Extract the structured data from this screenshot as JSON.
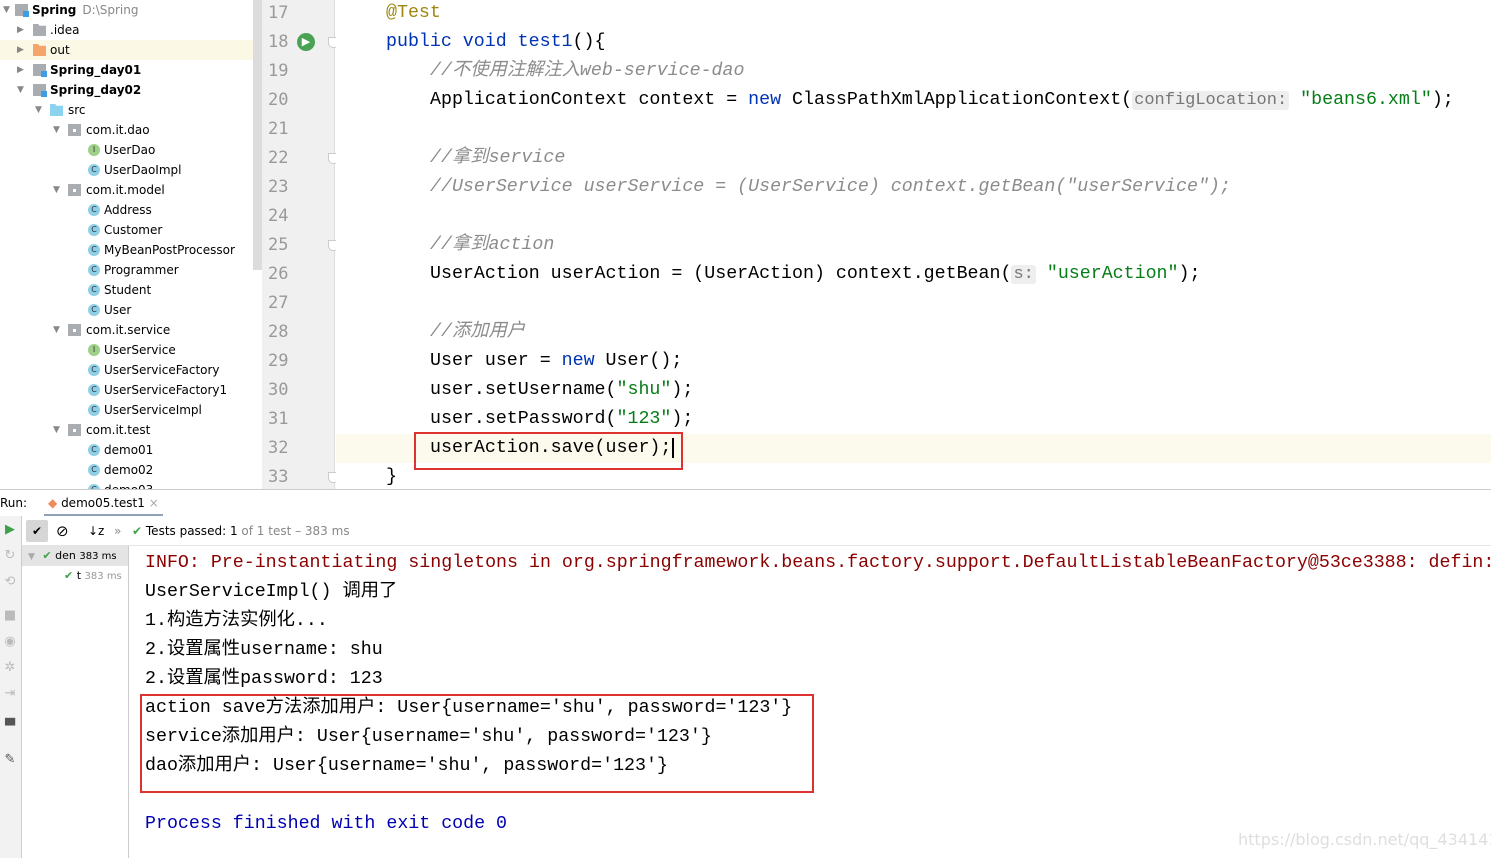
{
  "project_tree": [
    {
      "label": "Spring",
      "path": "D:\\Spring",
      "level": 0,
      "icon": "module",
      "expanded": true,
      "bold": true
    },
    {
      "label": ".idea",
      "level": 1,
      "icon": "folder",
      "expanded": false
    },
    {
      "label": "out",
      "level": 1,
      "icon": "folder-orange",
      "expanded": false,
      "selected": true
    },
    {
      "label": "Spring_day01",
      "level": 1,
      "icon": "module",
      "expanded": false,
      "bold": true
    },
    {
      "label": "Spring_day02",
      "level": 1,
      "icon": "module",
      "expanded": true,
      "bold": true
    },
    {
      "label": "src",
      "level": 2,
      "icon": "folder-blue",
      "expanded": true
    },
    {
      "label": "com.it.dao",
      "level": 3,
      "icon": "package",
      "expanded": true
    },
    {
      "label": "UserDao",
      "level": 4,
      "icon": "interface"
    },
    {
      "label": "UserDaoImpl",
      "level": 4,
      "icon": "class"
    },
    {
      "label": "com.it.model",
      "level": 3,
      "icon": "package",
      "expanded": true
    },
    {
      "label": "Address",
      "level": 4,
      "icon": "class"
    },
    {
      "label": "Customer",
      "level": 4,
      "icon": "class"
    },
    {
      "label": "MyBeanPostProcessor",
      "level": 4,
      "icon": "class"
    },
    {
      "label": "Programmer",
      "level": 4,
      "icon": "class"
    },
    {
      "label": "Student",
      "level": 4,
      "icon": "class"
    },
    {
      "label": "User",
      "level": 4,
      "icon": "class"
    },
    {
      "label": "com.it.service",
      "level": 3,
      "icon": "package",
      "expanded": true
    },
    {
      "label": "UserService",
      "level": 4,
      "icon": "interface"
    },
    {
      "label": "UserServiceFactory",
      "level": 4,
      "icon": "class"
    },
    {
      "label": "UserServiceFactory1",
      "level": 4,
      "icon": "class"
    },
    {
      "label": "UserServiceImpl",
      "level": 4,
      "icon": "class"
    },
    {
      "label": "com.it.test",
      "level": 3,
      "icon": "package",
      "expanded": true
    },
    {
      "label": "demo01",
      "level": 4,
      "icon": "test-class"
    },
    {
      "label": "demo02",
      "level": 4,
      "icon": "test-class"
    },
    {
      "label": "demo03",
      "level": 4,
      "icon": "test-class"
    }
  ],
  "editor": {
    "current_line": 32,
    "lines": [
      {
        "n": "17",
        "indent": 1,
        "tokens": [
          {
            "t": "@Test",
            "c": "ann"
          }
        ]
      },
      {
        "n": "18",
        "indent": 1,
        "tokens": [
          {
            "t": "public void ",
            "c": "kw"
          },
          {
            "t": "test1",
            "c": "kw"
          },
          {
            "t": "(){",
            "c": ""
          }
        ]
      },
      {
        "n": "19",
        "indent": 2,
        "tokens": [
          {
            "t": "//不使用注解注入web-service-dao",
            "c": "cm"
          }
        ]
      },
      {
        "n": "20",
        "indent": 2,
        "tokens": [
          {
            "t": "ApplicationContext context = ",
            "c": ""
          },
          {
            "t": "new ",
            "c": "kw"
          },
          {
            "t": "ClassPathXmlApplicationContext(",
            "c": ""
          },
          {
            "t": "configLocation:",
            "c": "hint"
          },
          {
            "t": " ",
            "c": ""
          },
          {
            "t": "\"beans6.xml\"",
            "c": "str"
          },
          {
            "t": ");",
            "c": ""
          }
        ]
      },
      {
        "n": "21",
        "indent": 2,
        "tokens": []
      },
      {
        "n": "22",
        "indent": 2,
        "tokens": [
          {
            "t": "//拿到service",
            "c": "cm"
          }
        ]
      },
      {
        "n": "23",
        "indent": 2,
        "tokens": [
          {
            "t": "//UserService userService = (UserService) context.getBean(\"userService\");",
            "c": "cm"
          }
        ]
      },
      {
        "n": "24",
        "indent": 2,
        "tokens": []
      },
      {
        "n": "25",
        "indent": 2,
        "tokens": [
          {
            "t": "//拿到action",
            "c": "cm"
          }
        ]
      },
      {
        "n": "26",
        "indent": 2,
        "tokens": [
          {
            "t": "UserAction userAction = (UserAction) context.getBean(",
            "c": ""
          },
          {
            "t": "s:",
            "c": "hint"
          },
          {
            "t": " ",
            "c": ""
          },
          {
            "t": "\"userAction\"",
            "c": "str"
          },
          {
            "t": ");",
            "c": ""
          }
        ]
      },
      {
        "n": "27",
        "indent": 2,
        "tokens": []
      },
      {
        "n": "28",
        "indent": 2,
        "tokens": [
          {
            "t": "//添加用户",
            "c": "cm"
          }
        ]
      },
      {
        "n": "29",
        "indent": 2,
        "tokens": [
          {
            "t": "User user = ",
            "c": ""
          },
          {
            "t": "new ",
            "c": "kw"
          },
          {
            "t": "User();",
            "c": ""
          }
        ]
      },
      {
        "n": "30",
        "indent": 2,
        "tokens": [
          {
            "t": "user.setUsername(",
            "c": ""
          },
          {
            "t": "\"shu\"",
            "c": "str"
          },
          {
            "t": ");",
            "c": ""
          }
        ]
      },
      {
        "n": "31",
        "indent": 2,
        "tokens": [
          {
            "t": "user.setPassword(",
            "c": ""
          },
          {
            "t": "\"123\"",
            "c": "str"
          },
          {
            "t": ");",
            "c": ""
          }
        ]
      },
      {
        "n": "32",
        "indent": 2,
        "tokens": [
          {
            "t": "userAction.save(user);",
            "c": ""
          }
        ]
      },
      {
        "n": "33",
        "indent": 1,
        "tokens": [
          {
            "t": "}",
            "c": ""
          }
        ]
      }
    ]
  },
  "run": {
    "label": "Run:",
    "tab": "demo05.test1",
    "status_prefix": "Tests passed:",
    "status_count": "1",
    "status_rest": "of 1 test – 383 ms",
    "tree": [
      {
        "label": "den",
        "time": "383 ms"
      },
      {
        "label": "t",
        "time": "383 ms"
      }
    ]
  },
  "console": [
    {
      "text": "INFO: Pre-instantiating singletons in org.springframework.beans.factory.support.DefaultListableBeanFactory@53ce3388: defin:",
      "c": "info"
    },
    {
      "text": "UserServiceImpl() 调用了",
      "c": ""
    },
    {
      "text": "1.构造方法实例化...",
      "c": ""
    },
    {
      "text": "2.设置属性username: shu",
      "c": ""
    },
    {
      "text": "2.设置属性password: 123",
      "c": ""
    },
    {
      "text": "action save方法添加用户: User{username='shu', password='123'}",
      "c": ""
    },
    {
      "text": "service添加用户: User{username='shu', password='123'}",
      "c": ""
    },
    {
      "text": "dao添加用户: User{username='shu', password='123'}",
      "c": ""
    },
    {
      "text": "",
      "c": ""
    },
    {
      "text": "Process finished with exit code 0",
      "c": "fin"
    }
  ],
  "watermark": "https://blog.csdn.net/qq_43414199",
  "colors": {
    "highlight_box": "#e03131",
    "keyword": "#0033b3",
    "string": "#067d17",
    "comment": "#8c8c8c",
    "info": "#8b0000"
  }
}
